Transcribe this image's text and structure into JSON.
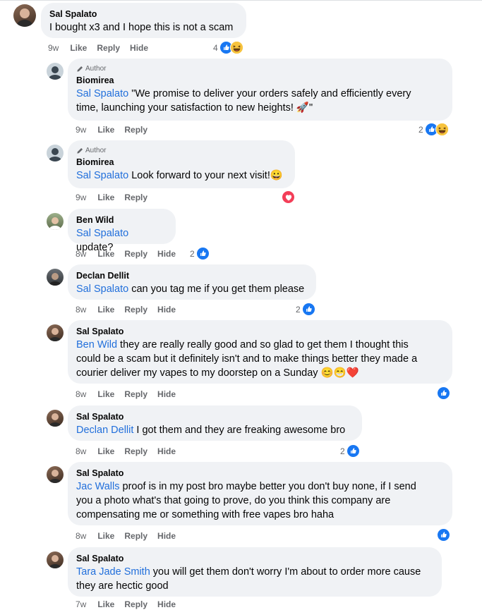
{
  "comments": [
    {
      "name": "Sal Spalato",
      "text": "I bought x3 and I hope this is not a scam",
      "time": "9w",
      "like": "Like",
      "reply": "Reply",
      "hide": "Hide",
      "reaction_count": "4"
    },
    {
      "badge": "Author",
      "name": "Biomirea",
      "mention": "Sal Spalato",
      "text": " \"We promise to deliver your orders safely and efficiently every",
      "text2": "time, launching your satisfaction to new heights! 🚀\"",
      "time": "9w",
      "like": "Like",
      "reply": "Reply",
      "reaction_count": "2"
    },
    {
      "badge": "Author",
      "name": "Biomirea",
      "mention": "Sal Spalato",
      "text": " Look forward to your next visit!😀",
      "time": "9w",
      "like": "Like",
      "reply": "Reply"
    },
    {
      "name": "Ben Wild",
      "mention": "Sal Spalato",
      "text": " update?",
      "time": "8w",
      "like": "Like",
      "reply": "Reply",
      "hide": "Hide",
      "reaction_count": "2"
    },
    {
      "name": "Declan Dellit",
      "mention": "Sal Spalato",
      "text": " can you tag me if you get them please",
      "time": "8w",
      "like": "Like",
      "reply": "Reply",
      "hide": "Hide",
      "reaction_count": "2"
    },
    {
      "name": "Sal Spalato",
      "mention": "Ben Wild",
      "text": " they are really really good and so glad to get them I thought this",
      "text2": "could be a scam but it definitely isn't and to make things better they made a",
      "text3": "courier deliver my vapes to my doorstep on a Sunday 😊😁❤️",
      "time": "8w",
      "like": "Like",
      "reply": "Reply",
      "hide": "Hide"
    },
    {
      "name": "Sal Spalato",
      "mention": "Declan Dellit",
      "text": " I got them and they are freaking awesome bro",
      "time": "8w",
      "like": "Like",
      "reply": "Reply",
      "hide": "Hide",
      "reaction_count": "2"
    },
    {
      "name": "Sal Spalato",
      "mention": "Jac Walls",
      "text": " proof is in my post bro maybe better you don't buy none, if I send",
      "text2": "you a photo what's that going to prove, do you think this company are",
      "text3": "compensating me or something with free vapes bro haha",
      "time": "8w",
      "like": "Like",
      "reply": "Reply",
      "hide": "Hide"
    },
    {
      "name": "Sal Spalato",
      "mention": "Tara Jade Smith",
      "text": " you will get them don't worry I'm about to order more cause",
      "text2": "they are hectic good",
      "time": "7w",
      "like": "Like",
      "reply": "Reply",
      "hide": "Hide"
    }
  ],
  "colors": {
    "mention": "#216fdb",
    "bubble": "#f0f2f5",
    "like": "#1877f2",
    "haha": "#f7c33e",
    "love": "#f33e58"
  },
  "icons": {
    "like": "thumbs-up-icon",
    "haha": "laughing-face-icon",
    "love": "heart-icon",
    "author": "pencil-icon"
  }
}
